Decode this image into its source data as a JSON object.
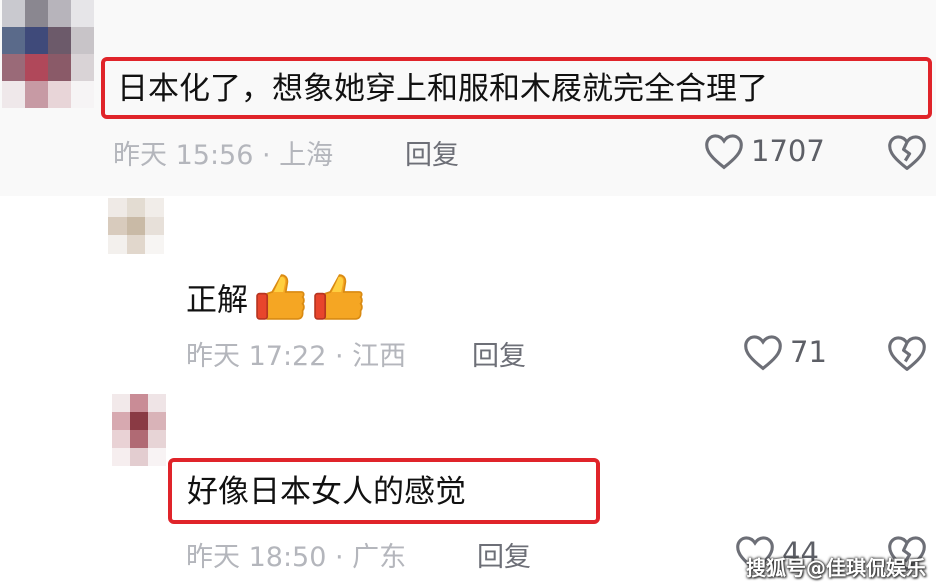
{
  "comments": [
    {
      "text": "日本化了，想象她穿上和服和木屐就完全合理了",
      "meta": "昨天 15:56 · 上海",
      "reply_label": "回复",
      "likes": "1707"
    },
    {
      "text": "正解",
      "emoji": [
        "thumbs-up",
        "thumbs-up"
      ],
      "meta": "昨天 17:22 · 江西",
      "reply_label": "回复",
      "likes": "71"
    },
    {
      "text": "好像日本女人的感觉",
      "meta": "昨天 18:50 · 广东",
      "reply_label": "回复",
      "likes": "44"
    }
  ],
  "watermark": "搜狐号@佳琪侃娱乐",
  "colors": {
    "highlight": "#e0242a",
    "meta": "#b4b6bc",
    "reply": "#6d6f77"
  }
}
